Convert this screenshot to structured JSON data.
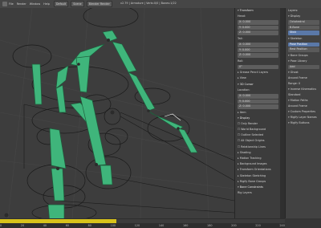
{
  "topbar": {
    "menus": [
      "File",
      "Render",
      "Window",
      "Help"
    ],
    "layout": "Default",
    "scene": "Scene",
    "engine": "Blender Render",
    "title": "v2.79 | Armature | Verts:0/0 | Bones:1/22"
  },
  "npanel": {
    "sections": [
      {
        "kind": "hdr",
        "text": "Transform"
      },
      {
        "kind": "text",
        "text": "Head:"
      },
      {
        "kind": "fld",
        "text": "X: 0.000"
      },
      {
        "kind": "fld",
        "text": "Y: 0.000"
      },
      {
        "kind": "fld",
        "text": "Z: 0.000"
      },
      {
        "kind": "text",
        "text": "Tail:"
      },
      {
        "kind": "fld",
        "text": "X: 0.000"
      },
      {
        "kind": "fld",
        "text": "Y: 0.000"
      },
      {
        "kind": "fld",
        "text": "Z: 0.000"
      },
      {
        "kind": "text",
        "text": "Roll:"
      },
      {
        "kind": "fld",
        "text": "0°"
      },
      {
        "kind": "hdrc",
        "text": "Grease Pencil Layers"
      },
      {
        "kind": "hdrc",
        "text": "View"
      },
      {
        "kind": "hdr",
        "text": "3D Cursor"
      },
      {
        "kind": "text",
        "text": "Location:"
      },
      {
        "kind": "fld",
        "text": "X: 0.000"
      },
      {
        "kind": "fld",
        "text": "Y: 0.000"
      },
      {
        "kind": "fld",
        "text": "Z: 0.000"
      },
      {
        "kind": "hdrc",
        "text": "Item"
      },
      {
        "kind": "hdr",
        "text": "Display"
      },
      {
        "kind": "chk",
        "text": "Only Render"
      },
      {
        "kind": "chk",
        "text": "World Background"
      },
      {
        "kind": "chk",
        "text": "Outline Selected"
      },
      {
        "kind": "chk",
        "text": "All Object Origins"
      },
      {
        "kind": "chk",
        "text": "Relationship Lines"
      },
      {
        "kind": "hdrc",
        "text": "Shading"
      },
      {
        "kind": "hdrc",
        "text": "Motion Tracking"
      },
      {
        "kind": "hdrc",
        "text": "Background Images"
      },
      {
        "kind": "hdrc",
        "text": "Transform Orientations"
      },
      {
        "kind": "hdrc",
        "text": "Skeleton Sketching"
      },
      {
        "kind": "hdrc",
        "text": "Rigify Bone Groups"
      },
      {
        "kind": "hdr",
        "text": "Bone Constraints"
      },
      {
        "kind": "text",
        "text": "Rig Layers"
      }
    ]
  },
  "props": {
    "rows": [
      {
        "kind": "text",
        "text": "Layers:"
      },
      {
        "kind": "hdr",
        "text": "Display"
      },
      {
        "kind": "btn",
        "text": "Octahedral"
      },
      {
        "kind": "btn",
        "text": "B-Bone"
      },
      {
        "kind": "btn blue",
        "text": "Stick"
      },
      {
        "kind": "hdr",
        "text": "Skeleton"
      },
      {
        "kind": "btn blue",
        "text": "Pose Position"
      },
      {
        "kind": "btn",
        "text": "Rest Position"
      },
      {
        "kind": "hdr",
        "text": "Bone Groups"
      },
      {
        "kind": "hdr",
        "text": "Pose Library"
      },
      {
        "kind": "btn",
        "text": "Add"
      },
      {
        "kind": "hdr",
        "text": "Ghost"
      },
      {
        "kind": "text",
        "text": "Around Frame"
      },
      {
        "kind": "text",
        "text": "Range: 0"
      },
      {
        "kind": "hdr",
        "text": "Inverse Kinematics"
      },
      {
        "kind": "text",
        "text": "Standard"
      },
      {
        "kind": "hdr",
        "text": "Motion Paths"
      },
      {
        "kind": "text",
        "text": "Around Frame"
      },
      {
        "kind": "hdr",
        "text": "Custom Properties"
      },
      {
        "kind": "hdr",
        "text": "Rigify Layer Names"
      },
      {
        "kind": "hdr",
        "text": "Rigify Buttons"
      }
    ]
  },
  "timeline": {
    "marks": [
      "0",
      "20",
      "40",
      "60",
      "80",
      "100",
      "120",
      "140",
      "160",
      "180",
      "200",
      "220",
      "240"
    ]
  },
  "colors": {
    "bone_fill": "#3fb57b",
    "bone_stroke": "#1f5e3d",
    "timeline_progress": "#d8c21b",
    "selection_blue": "#5a78a8"
  }
}
